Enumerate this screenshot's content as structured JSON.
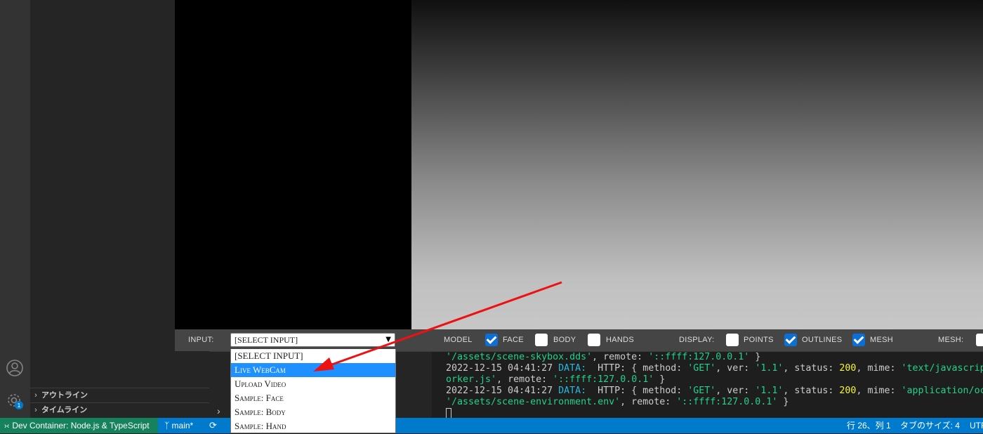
{
  "sidebar": {
    "sections": [
      {
        "label": "アウトライン"
      },
      {
        "label": "タイムライン"
      }
    ],
    "settings_badge": "1"
  },
  "app": {
    "toolbar": {
      "input_label": "INPUT:",
      "input_selected": "[SELECT INPUT]",
      "model_label": "MODEL",
      "face_label": "FACE",
      "face_checked": true,
      "body_label": "BODY",
      "body_checked": false,
      "hands_label": "HANDS",
      "hands_checked": false,
      "display_label": "DISPLAY:",
      "points_label": "POINTS",
      "points_checked": false,
      "outlines_label": "OUTLINES",
      "outlines_checked": true,
      "mesh_label": "MESH",
      "mesh_checked": true,
      "mesh2_label": "MESH:"
    },
    "dropdown_options": [
      "[SELECT INPUT]",
      "Live WebCam",
      "Upload Video",
      "Sample: Face",
      "Sample: Body",
      "Sample: Hand"
    ],
    "highlighted_option_index": 1
  },
  "terminal": {
    "line1": {
      "a": "'/assets/scene-skybox.dds'",
      "b": ", remote: ",
      "c": "'::ffff:127.0.0.1'",
      "d": " }"
    },
    "line2": {
      "ts": "2022-12-15 04:41:27 ",
      "lvl": "DATA:",
      "a": "  HTTP: { method: ",
      "m": "'GET'",
      "b": ", ver: ",
      "v": "'1.1'",
      "c": ", status: ",
      "s": "200",
      "d": ", mime: ",
      "mime": "'text/javascript"
    },
    "line3": {
      "a": "orker.js'",
      "b": ", remote: ",
      "c": "'::ffff:127.0.0.1'",
      "d": " }"
    },
    "line4": {
      "ts": "2022-12-15 04:41:27 ",
      "lvl": "DATA:",
      "a": "  HTTP: { method: ",
      "m": "'GET'",
      "b": ", ver: ",
      "v": "'1.1'",
      "c": ", status: ",
      "s": "200",
      "d": ", mime: ",
      "mime": "'application/oct"
    },
    "line5": {
      "a": "'/assets/scene-environment.env'",
      "b": ", remote: ",
      "c": "'::ffff:127.0.0.1'",
      "d": " }"
    }
  },
  "statusbar": {
    "remote": "Dev Container: Node.js & TypeScript",
    "branch": "main*",
    "position": "行 26、列 1",
    "tab_size": "タブのサイズ: 4",
    "encoding": "UTF"
  },
  "colors": {
    "accent": "#007acc",
    "remote": "#16825d",
    "annotation_arrow": "#ee1111"
  }
}
